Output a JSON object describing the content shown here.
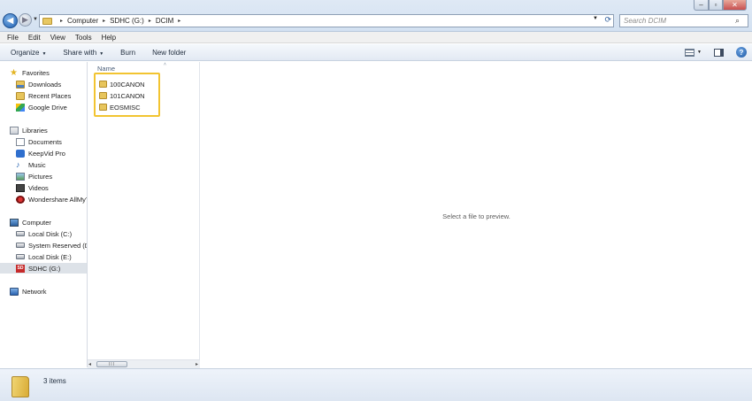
{
  "window": {
    "minimize_glyph": "–",
    "maximize_glyph": "▫",
    "close_glyph": "✕"
  },
  "navigation": {
    "back_glyph": "◀",
    "forward_glyph": "▶",
    "history_glyph": "▼"
  },
  "address_bar": {
    "breadcrumbs": [
      "Computer",
      "SDHC (G:)",
      "DCIM"
    ],
    "separator": "▸",
    "dropdown_glyph": "▼",
    "refresh_glyph": "⟳"
  },
  "search": {
    "placeholder": "Search DCIM",
    "icon": "search-icon",
    "icon_glyph": "⌕"
  },
  "menu": [
    "File",
    "Edit",
    "View",
    "Tools",
    "Help"
  ],
  "command_bar": {
    "organize": "Organize",
    "share_with": "Share with",
    "burn": "Burn",
    "new_folder": "New folder",
    "caret": "▼",
    "help_glyph": "?"
  },
  "nav_pane": {
    "favorites": {
      "label": "Favorites",
      "items": [
        "Downloads",
        "Recent Places",
        "Google Drive"
      ]
    },
    "libraries": {
      "label": "Libraries",
      "items": [
        "Documents",
        "KeepVid Pro",
        "Music",
        "Pictures",
        "Videos",
        "Wondershare AllMyTube"
      ]
    },
    "computer": {
      "label": "Computer",
      "items": [
        "Local Disk (C:)",
        "System Reserved (D:)",
        "Local Disk (E:)",
        "SDHC (G:)"
      ],
      "selected": "SDHC (G:)"
    },
    "network": {
      "label": "Network"
    },
    "sd_icon_text": "SD",
    "music_glyph": "♪",
    "star_glyph": "★"
  },
  "file_list": {
    "column_name": "Name",
    "sort_glyph": "˄",
    "items": [
      "100CANON",
      "101CANON",
      "EOSMISC"
    ]
  },
  "scrollbar": {
    "left_glyph": "◂",
    "right_glyph": "▸",
    "grip": "III"
  },
  "preview": {
    "message": "Select a file to preview."
  },
  "details": {
    "item_count": "3 items"
  },
  "colors": {
    "selection_highlight": "#f2c431",
    "folder": "#e7c55c",
    "accent": "#1f5fb0"
  }
}
